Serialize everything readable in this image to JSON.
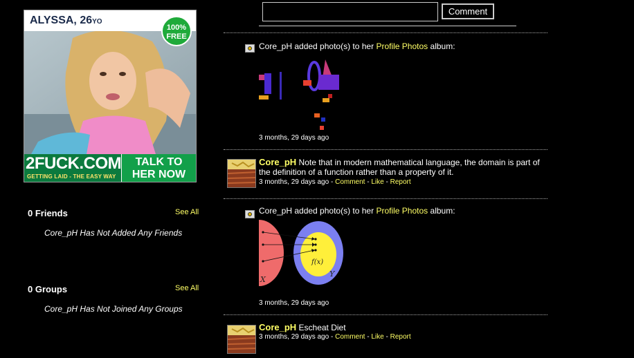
{
  "ad": {
    "name_age": "ALYSSA, 26",
    "age_suffix": "YO",
    "badge": "100% FREE",
    "brand": "2FUCK.COM",
    "tagline": "GETTING LAID - THE EASY WAY",
    "cta_line1": "TALK TO",
    "cta_line2": "HER NOW"
  },
  "sidebar": {
    "friends": {
      "title": "0 Friends",
      "see_all": "See All",
      "empty": "Core_pH Has Not Added Any Friends"
    },
    "groups": {
      "title": "0 Groups",
      "see_all": "See All",
      "empty": "Core_pH Has Not Joined Any Groups"
    }
  },
  "comment_box": {
    "value": "",
    "button": "Comment"
  },
  "feed": {
    "item1": {
      "prefix": "Core_pH added photo(s) to her",
      "link": "Profile Photos",
      "suffix": "album:",
      "time": "3 months, 29 days ago"
    },
    "item2": {
      "user": "Core_pH",
      "text": "Note that in modern mathematical language, the domain is part of the definition of a function rather than a property of it.",
      "time": "3 months, 29 days ago",
      "sep": "-",
      "comment": "Comment",
      "like": "Like",
      "report": "Report"
    },
    "item3": {
      "prefix": "Core_pH added photo(s) to her",
      "link": "Profile Photos",
      "suffix": "album:",
      "time": "3 months, 29 days ago",
      "label_x": "X",
      "label_y": "Y",
      "label_fx": "f(x)"
    },
    "item4": {
      "user": "Core_pH",
      "text": "Escheat Diet",
      "time": "3 months, 29 days ago",
      "sep": "-",
      "comment": "Comment",
      "like": "Like",
      "report": "Report"
    }
  },
  "colors": {
    "background": "#000000",
    "link": "#ffff66",
    "ad_green": "#0b7a3e"
  }
}
